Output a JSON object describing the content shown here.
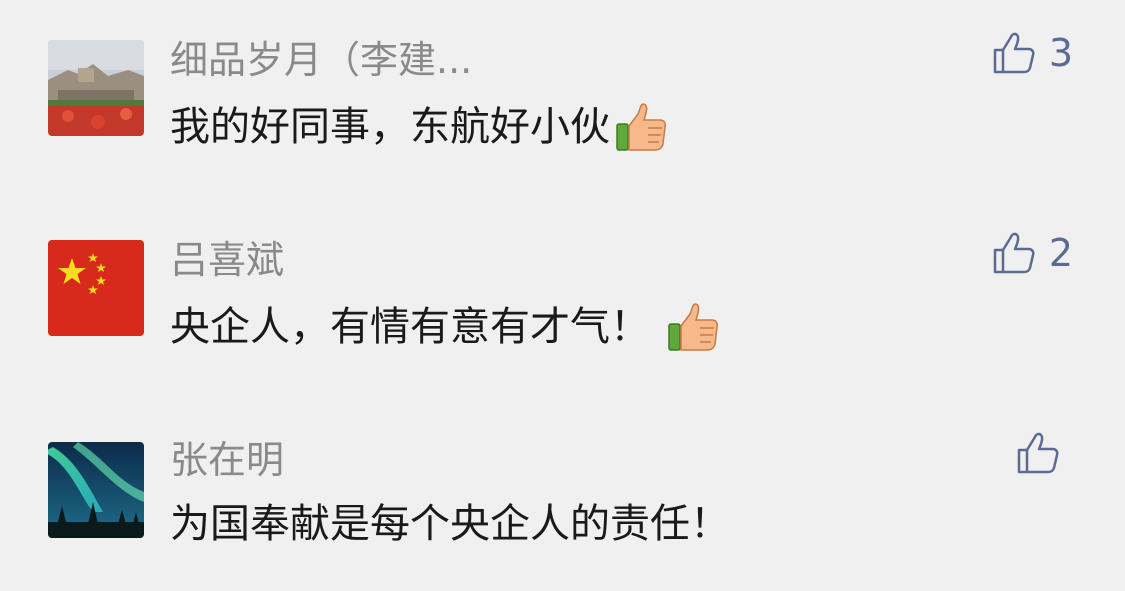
{
  "comments": [
    {
      "author": "细品岁月（李建...",
      "text": "我的好同事，东航好小伙",
      "has_emoji": true,
      "like_count": "3",
      "avatar_icon": "landscape-photo"
    },
    {
      "author": "吕喜斌",
      "text": "央企人，有情有意有才气！",
      "has_emoji": true,
      "like_count": "2",
      "avatar_icon": "china-flag"
    },
    {
      "author": "张在明",
      "text": "为国奉献是每个央企人的责任！",
      "has_emoji": false,
      "like_count": "",
      "avatar_icon": "aurora-photo"
    }
  ],
  "colors": {
    "background": "#f0f0f0",
    "author": "#8a8a8a",
    "text": "#1a1a1a",
    "like": "#5b6b93"
  }
}
